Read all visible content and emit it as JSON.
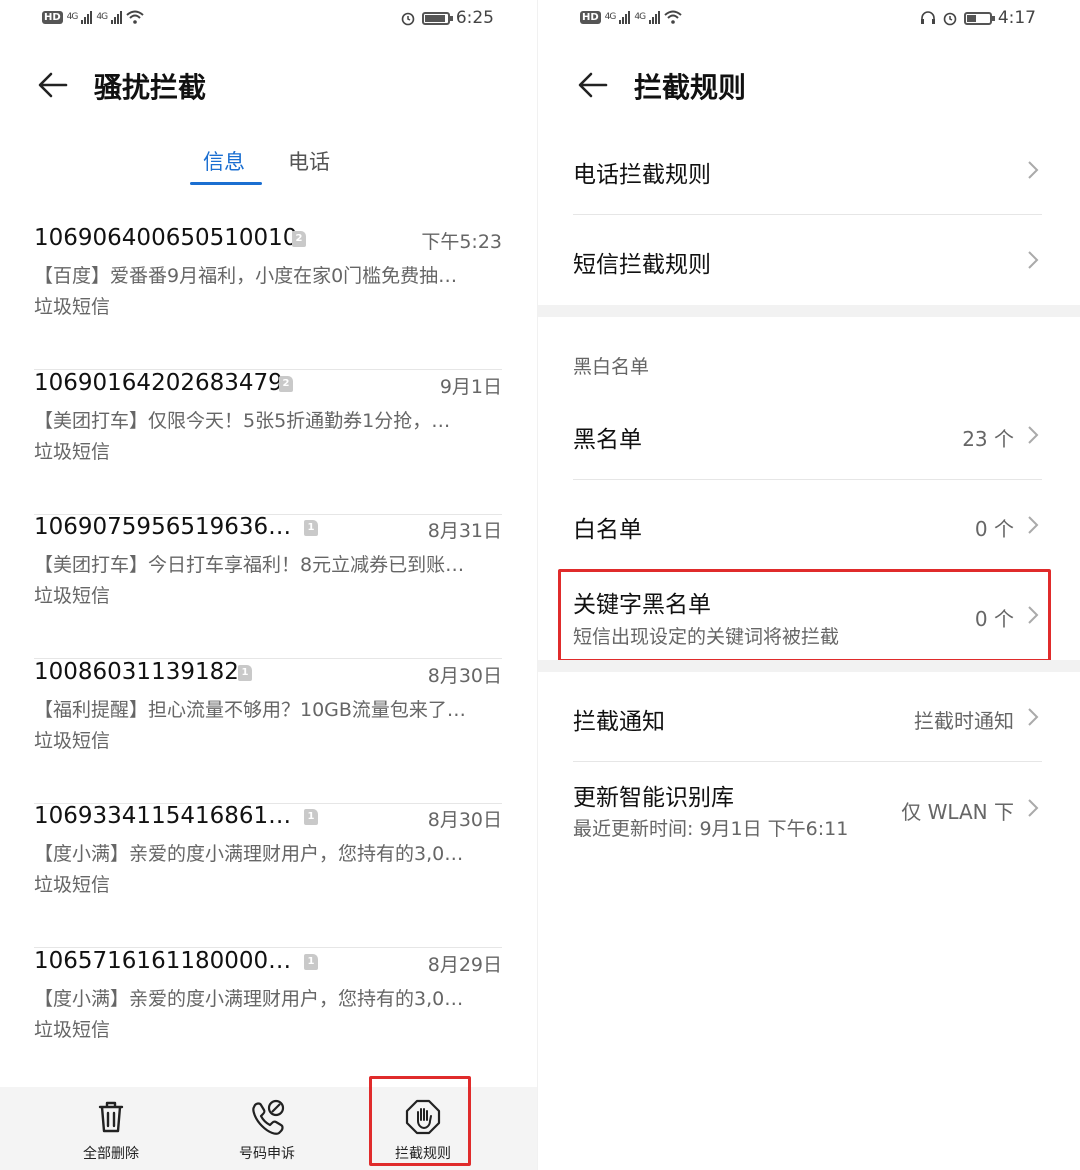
{
  "left": {
    "status": {
      "time": "6:25",
      "network1": "4G",
      "network2": "4G"
    },
    "header": {
      "title": "骚扰拦截"
    },
    "tabs": [
      {
        "label": "信息"
      },
      {
        "label": "电话"
      }
    ],
    "messages": [
      {
        "sender": "106906400650510010",
        "sim": "2",
        "time": "下午5:23",
        "preview": "【百度】爱番番9月福利，小度在家0门槛免费抽…",
        "tag": "垃圾短信"
      },
      {
        "sender": "10690164202683479",
        "sim": "2",
        "time": "9月1日",
        "preview": "【美团打车】仅限今天！5张5折通勤券1分抢，…",
        "tag": "垃圾短信"
      },
      {
        "sender": "1069075956519636…",
        "sim": "1",
        "time": "8月31日",
        "preview": "【美团打车】今日打车享福利！8元立减券已到账…",
        "tag": "垃圾短信"
      },
      {
        "sender": "10086031139182",
        "sim": "1",
        "time": "8月30日",
        "preview": "【福利提醒】担心流量不够用？10GB流量包来了…",
        "tag": "垃圾短信"
      },
      {
        "sender": "1069334115416861…",
        "sim": "1",
        "time": "8月30日",
        "preview": "【度小满】亲爱的度小满理财用户，您持有的3,0…",
        "tag": "垃圾短信"
      },
      {
        "sender": "1065716161180000…",
        "sim": "1",
        "time": "8月29日",
        "preview": "【度小满】亲爱的度小满理财用户，您持有的3,0…",
        "tag": "垃圾短信"
      }
    ],
    "bottom": {
      "delete_all": "全部删除",
      "appeal": "号码申诉",
      "rules": "拦截规则"
    }
  },
  "right": {
    "status": {
      "time": "4:17",
      "network1": "4G",
      "network2": "4G"
    },
    "header": {
      "title": "拦截规则"
    },
    "call_rules": "电话拦截规则",
    "sms_rules": "短信拦截规则",
    "section_bw": "黑白名单",
    "blacklist": {
      "label": "黑名单",
      "value": "23 个"
    },
    "whitelist": {
      "label": "白名单",
      "value": "0 个"
    },
    "keyword_blacklist": {
      "label": "关键字黑名单",
      "sub": "短信出现设定的关键词将被拦截",
      "value": "0 个"
    },
    "notify": {
      "label": "拦截通知",
      "value": "拦截时通知"
    },
    "update": {
      "label": "更新智能识别库",
      "sub": "最近更新时间: 9月1日 下午6:11",
      "value": "仅 WLAN 下"
    }
  }
}
